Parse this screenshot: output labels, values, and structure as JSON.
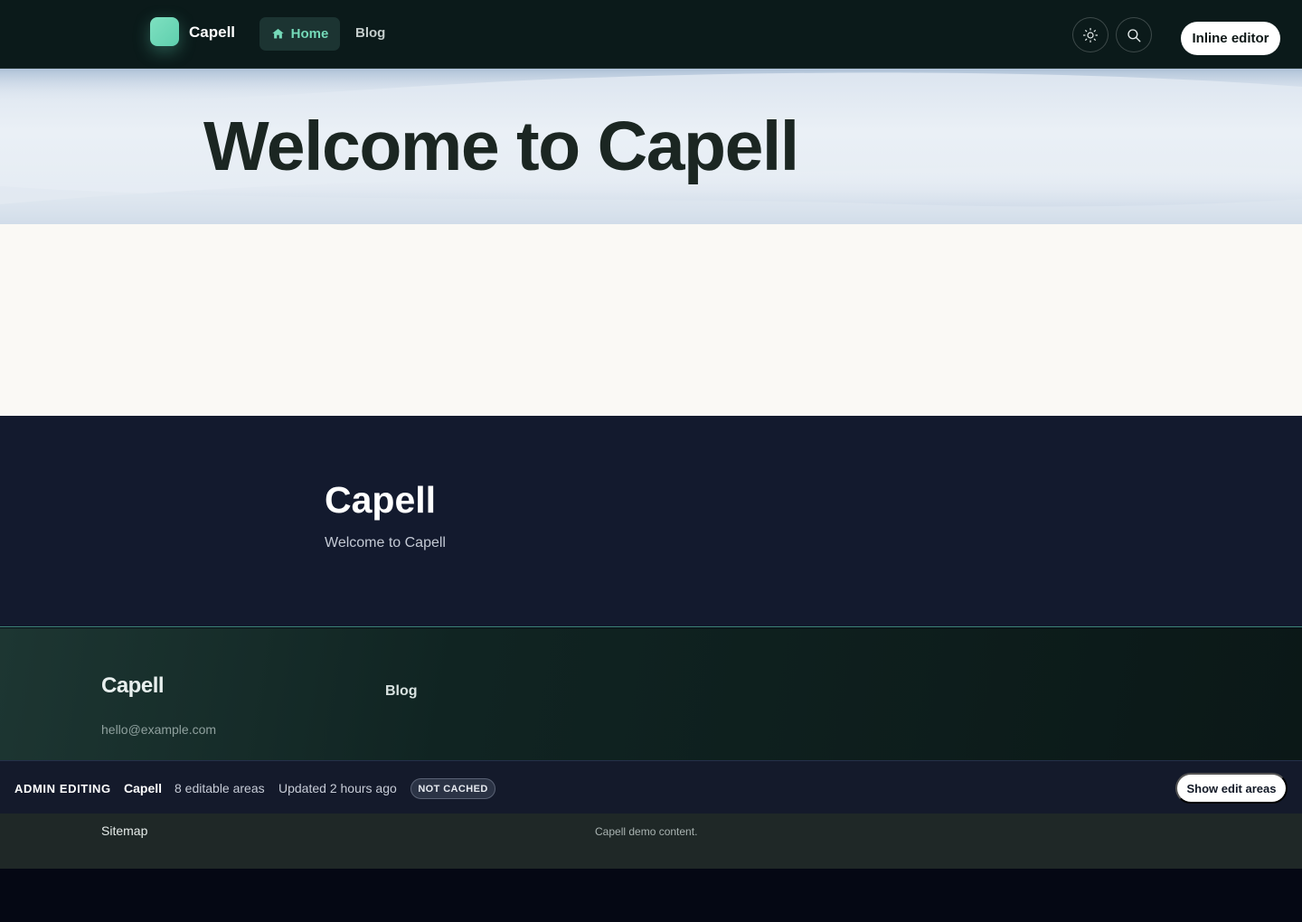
{
  "header": {
    "brand": "Capell",
    "nav": [
      {
        "label": "Home",
        "icon": "home-icon",
        "active": true
      },
      {
        "label": "Blog",
        "active": false
      }
    ],
    "theme_toggle_icon": "sun-icon",
    "search_icon": "search-icon",
    "inline_editor_label": "Inline editor",
    "accent_color": "#74d9b8"
  },
  "hero": {
    "title": "Welcome to Capell"
  },
  "intro": {
    "title": "Capell",
    "subtitle": "Welcome to Capell"
  },
  "footer": {
    "brand": "Capell",
    "email": "hello@example.com",
    "links": [
      "Blog"
    ]
  },
  "admin_bar": {
    "label": "ADMIN EDITING",
    "site": "Capell",
    "editable_areas": "8 editable areas",
    "updated": "Updated 2 hours ago",
    "cache_badge": "NOT CACHED",
    "show_edit_areas_label": "Show edit areas"
  },
  "bottom_bar": {
    "sitemap": "Sitemap",
    "demo_note": "Capell demo content."
  }
}
